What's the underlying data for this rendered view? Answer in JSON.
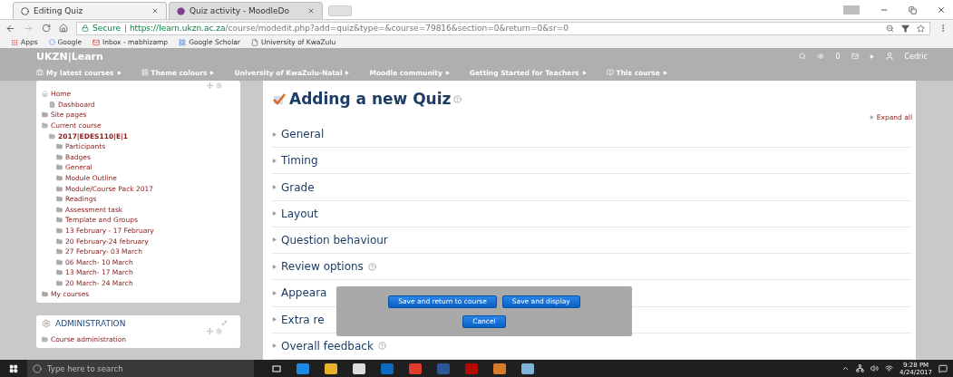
{
  "browser": {
    "tabs": [
      {
        "title": "Editing Quiz",
        "selected": true
      },
      {
        "title": "Quiz activity - MoodleDo",
        "selected": false
      }
    ],
    "address": {
      "secure_label": "Secure",
      "separator": "|",
      "url_host": "https://learn.ukzn.ac.za",
      "url_path": "/course/modedit.php?add=quiz&type=&course=79816&section=0&return=0&sr=0"
    },
    "bookmarks": [
      "Apps",
      "Google",
      "Inbox - mabhizamp",
      "Google Scholar",
      "University of KwaZulu"
    ]
  },
  "site": {
    "brand": "UKZN|Learn",
    "messages": "0",
    "user": "Cedric",
    "menu": [
      "My latest courses",
      "Theme colours",
      "University of KwaZulu-Natal",
      "Moodle community",
      "Getting Started for Teachers",
      "This course"
    ]
  },
  "navigation": {
    "items": [
      {
        "label": "Home",
        "kind": "home",
        "children": [
          {
            "label": "Dashboard",
            "kind": "page"
          }
        ]
      },
      {
        "label": "Site pages",
        "kind": "folder"
      },
      {
        "label": "Current course",
        "kind": "folder",
        "children": [
          {
            "label": "2017|EDES110|E|1",
            "kind": "course",
            "children": [
              {
                "label": "Participants",
                "kind": "folder"
              },
              {
                "label": "Badges",
                "kind": "folder"
              },
              {
                "label": "General",
                "kind": "folder"
              },
              {
                "label": "Module Outline",
                "kind": "folder"
              },
              {
                "label": "Module/Course Pack 2017",
                "kind": "folder"
              },
              {
                "label": "Readings",
                "kind": "folder"
              },
              {
                "label": "Assessment task",
                "kind": "folder"
              },
              {
                "label": "Template and Groups",
                "kind": "folder"
              },
              {
                "label": "13 February - 17 February",
                "kind": "folder"
              },
              {
                "label": "20 February-24 february",
                "kind": "folder"
              },
              {
                "label": "27 February- 03 March",
                "kind": "folder"
              },
              {
                "label": "06 March- 10 March",
                "kind": "folder"
              },
              {
                "label": "13 March- 17 March",
                "kind": "folder"
              },
              {
                "label": "20 March- 24 March",
                "kind": "folder"
              }
            ]
          }
        ]
      },
      {
        "label": "My courses",
        "kind": "folder"
      }
    ]
  },
  "administration": {
    "title": "ADMINISTRATION",
    "items": [
      {
        "label": "Course administration",
        "kind": "open-folder"
      }
    ]
  },
  "page": {
    "title": "Adding a new Quiz",
    "expand_all": "Expand all",
    "sections": [
      {
        "label": "General",
        "help": false
      },
      {
        "label": "Timing",
        "help": false
      },
      {
        "label": "Grade",
        "help": false
      },
      {
        "label": "Layout",
        "help": false
      },
      {
        "label": "Question behaviour",
        "help": false
      },
      {
        "label": "Review options",
        "help": true
      },
      {
        "label": "Appeara",
        "help": false
      },
      {
        "label": "Extra re",
        "help": false
      },
      {
        "label": "Overall feedback",
        "help": true
      }
    ]
  },
  "actions": {
    "buttons": [
      "Save and return to course",
      "Save and display",
      "Cancel"
    ]
  },
  "taskbar": {
    "search_placeholder": "Type here to search",
    "time": "9:28 PM",
    "date": "4/24/2017"
  }
}
